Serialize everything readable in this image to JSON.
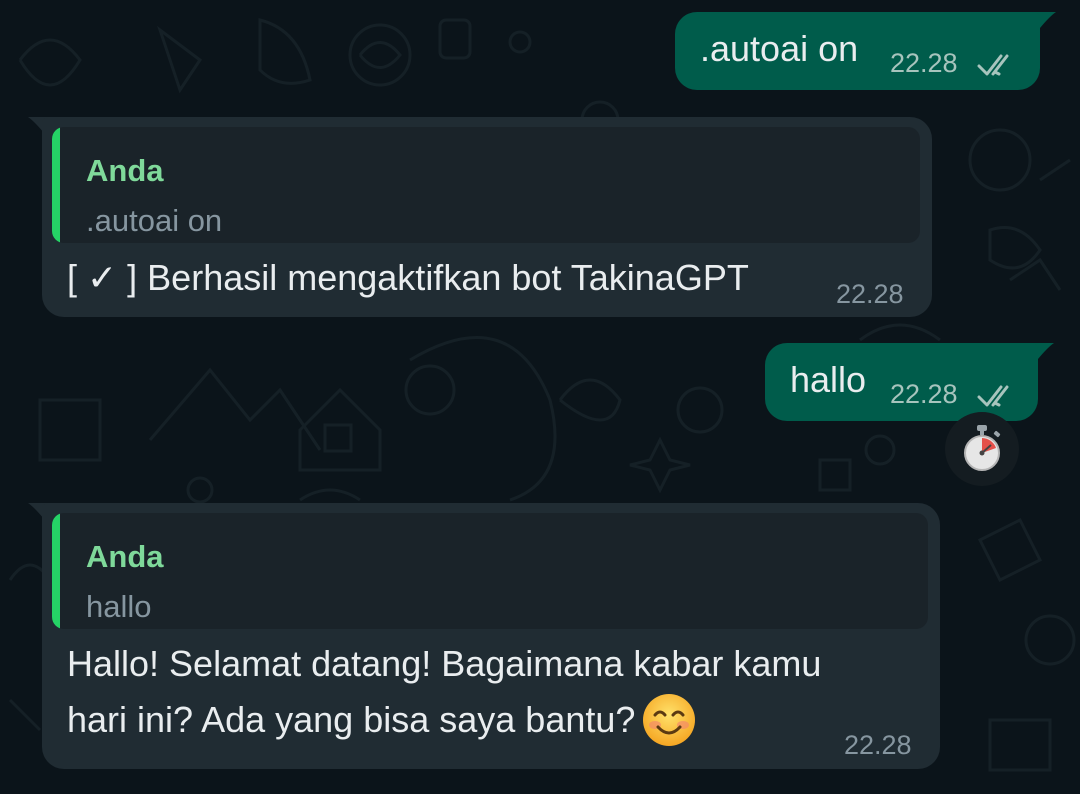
{
  "messages": [
    {
      "direction": "outgoing",
      "text": ".autoai on",
      "time": "22.28",
      "status": "read",
      "status_icon": "double-check-icon"
    },
    {
      "direction": "incoming",
      "reply_to": {
        "author": "Anda",
        "text": ".autoai on"
      },
      "text": "[ ✓ ] Berhasil mengaktifkan bot TakinaGPT",
      "time": "22.28"
    },
    {
      "direction": "outgoing",
      "text": "hallo",
      "time": "22.28",
      "status": "read",
      "status_icon": "double-check-icon",
      "reaction_icon": "stopwatch-icon"
    },
    {
      "direction": "incoming",
      "reply_to": {
        "author": "Anda",
        "text": "hallo"
      },
      "text_line1": "Hallo! Selamat datang! Bagaimana kabar kamu",
      "text_line2": "hari ini? Ada yang bisa saya bantu?",
      "emoji": "smiling-face-icon",
      "time": "22.28"
    }
  ],
  "colors": {
    "background": "#0b141a",
    "outgoing_bubble": "#005c4b",
    "incoming_bubble": "#202c33",
    "quote_bar": "#25d366",
    "quote_author": "#7fd99a",
    "timestamp": "#8696a0"
  }
}
